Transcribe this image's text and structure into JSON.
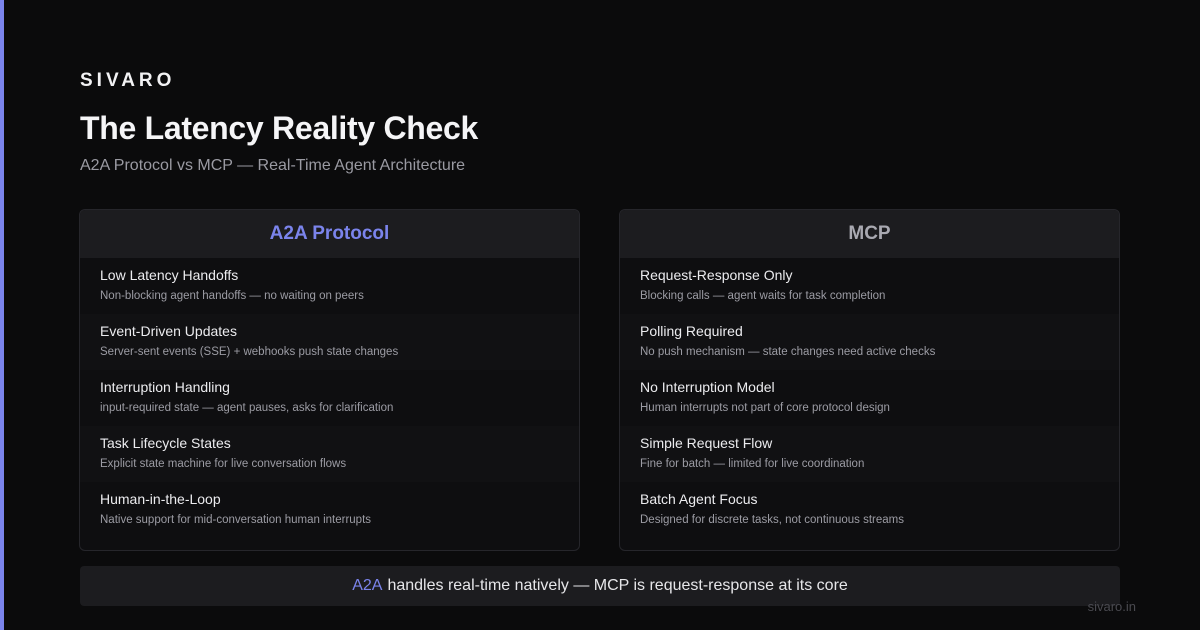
{
  "brand": "SIVARO",
  "title": "The Latency Reality Check",
  "subtitle": "A2A Protocol vs MCP — Real-Time Agent Architecture",
  "colors": {
    "accent": "#7b84ec",
    "background": "#0b0b0c",
    "card_header": "#1c1c1f"
  },
  "left_card": {
    "heading": "A2A Protocol",
    "rows": [
      {
        "title": "Low Latency Handoffs",
        "desc": "Non-blocking agent handoffs — no waiting on peers"
      },
      {
        "title": "Event-Driven Updates",
        "desc": "Server-sent events (SSE) + webhooks push state changes"
      },
      {
        "title": "Interruption Handling",
        "desc": "input-required state — agent pauses, asks for clarification"
      },
      {
        "title": "Task Lifecycle States",
        "desc": "Explicit state machine for live conversation flows"
      },
      {
        "title": "Human-in-the-Loop",
        "desc": "Native support for mid-conversation human interrupts"
      }
    ]
  },
  "right_card": {
    "heading": "MCP",
    "rows": [
      {
        "title": "Request-Response Only",
        "desc": "Blocking calls — agent waits for task completion"
      },
      {
        "title": "Polling Required",
        "desc": "No push mechanism — state changes need active checks"
      },
      {
        "title": "No Interruption Model",
        "desc": "Human interrupts not part of core protocol design"
      },
      {
        "title": "Simple Request Flow",
        "desc": "Fine for batch — limited for live coordination"
      },
      {
        "title": "Batch Agent Focus",
        "desc": "Designed for discrete tasks, not continuous streams"
      }
    ]
  },
  "footer": {
    "highlight": "A2A",
    "text": "handles real-time natively — MCP is request-response at its core"
  },
  "site": "sivaro.in"
}
